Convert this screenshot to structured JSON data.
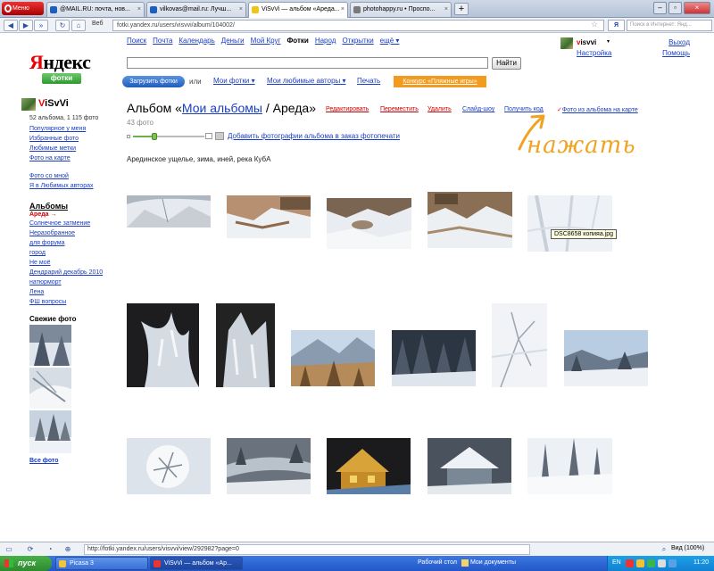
{
  "browser": {
    "menu_label": "Меню",
    "tabs": [
      {
        "label": "@MAIL.RU: почта, нов..."
      },
      {
        "label": "vilkovas@mail.ru: Лучш..."
      },
      {
        "label": "ViSvVi — альбом «Ареда..."
      },
      {
        "label": "photohappy.ru • Проспо..."
      }
    ],
    "web_label": "Веб",
    "address": "fotki.yandex.ru/users/visvvi/album/104002/",
    "search_engine": "Я",
    "search_placeholder": "Поиск в Интернет: Янд..."
  },
  "site": {
    "logo": "Яндекс",
    "logo_first_letter": "Я",
    "logo_rest": "ндекс",
    "service_badge": "фотки",
    "nav": [
      "Поиск",
      "Почта",
      "Календарь",
      "Деньги",
      "Мой Круг",
      "Фотки",
      "Народ",
      "Открытки",
      "ещё ▾"
    ],
    "search_button": "Найти",
    "user": {
      "name_first": "v",
      "name_rest": "isvvi",
      "menu_arrow": "▾"
    },
    "settings": "Настройка",
    "logout": "Выход",
    "help": "Помощь",
    "upload_button": "Загрузить фотки",
    "or": "или",
    "my_photos": "Мои фотки ▾",
    "fav_authors": "Мои любимые авторы ▾",
    "print": "Печать",
    "contest": "Конкурс «Пляжные игры»"
  },
  "sidebar": {
    "username_first": "V",
    "username_rest": "iSvVi",
    "stats": "52 альбома, 1 115 фото",
    "links": [
      "Популярное у меня",
      "Избранные фото",
      "Любимые метки",
      "Фото на карте"
    ],
    "links2": [
      "Фото со мной",
      "Я в Любимых авторах"
    ],
    "albums_heading": "Альбомы",
    "current_album": "Ареда →",
    "albums": [
      "Солнечное затмение",
      "Неразобранное",
      "для форума",
      "город",
      "Не моё",
      "Дендрарий декабрь 2010",
      "натюрморт",
      "Лена",
      "ФШ вопросы"
    ],
    "fresh_heading": "Свежие фото",
    "all_photos": "Все фото"
  },
  "album": {
    "title_prefix": "Альбом «",
    "title_link": "Мои альбомы",
    "title_suffix": " / Ареда»",
    "actions": {
      "edit": "Редактировать",
      "move": "Переместить",
      "delete": "Удалить",
      "slideshow": "Слайд-шоу",
      "get_code": "Получить код",
      "map": "Фото из альбома на карте",
      "map_tick": "✓"
    },
    "photo_count": "43 фото",
    "thumb_size": 0.3,
    "order_print": "Добавить фотографии альбома в заказ фотопечати",
    "description": "Арединское ущелье, зима, иней, река КубА",
    "annotation": "нажать",
    "tooltip": "DSC8658 копияa.jpg"
  },
  "photos": [
    {
      "name": "photo-1",
      "kind": "snow"
    },
    {
      "name": "photo-2",
      "kind": "rocks-snow"
    },
    {
      "name": "photo-3",
      "kind": "rocks-snow"
    },
    {
      "name": "photo-4",
      "kind": "rocks-snow"
    },
    {
      "name": "photo-5",
      "kind": "snow-shadow"
    },
    {
      "name": "photo-6",
      "kind": "frost-dark"
    },
    {
      "name": "photo-7",
      "kind": "frost-dark"
    },
    {
      "name": "photo-8",
      "kind": "mountain"
    },
    {
      "name": "photo-9",
      "kind": "forest-dark"
    },
    {
      "name": "photo-10",
      "kind": "sun-forest"
    },
    {
      "name": "photo-11",
      "kind": "frost-branches"
    },
    {
      "name": "photo-12",
      "kind": "snow-forest"
    },
    {
      "name": "photo-13",
      "kind": "snow-tree"
    },
    {
      "name": "photo-14",
      "kind": "river-fog"
    },
    {
      "name": "photo-15",
      "kind": "house-sunset"
    },
    {
      "name": "photo-16",
      "kind": "roof-snow"
    },
    {
      "name": "photo-17",
      "kind": "snow-trees"
    }
  ],
  "status": {
    "url": "http://fotki.yandex.ru/users/visvvi/view/292982?page=0",
    "zoom": "Вид (100%)"
  },
  "taskbar": {
    "start": "пуск",
    "buttons": [
      "Picasa 3",
      "ViSvVi — альбом «Ар..."
    ],
    "desktop": "Рабочий стол",
    "my_documents": "Мои документы",
    "lang": "EN",
    "clock": "11:20"
  },
  "colors": {
    "link": "#1a3dc1",
    "danger": "#cc0000",
    "accent_orange": "#f29b1f",
    "annotation": "#f0a321"
  }
}
